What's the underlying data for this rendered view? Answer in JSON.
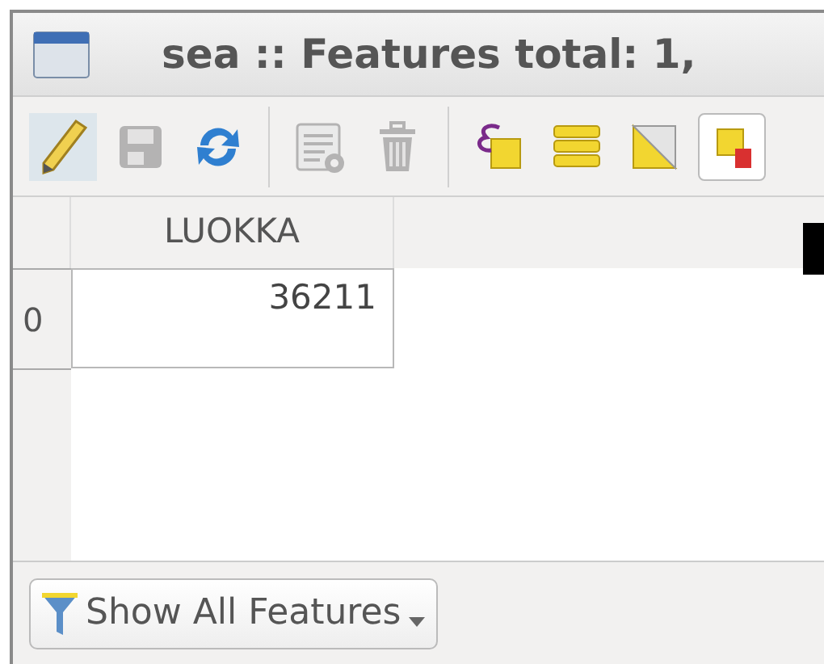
{
  "window": {
    "title": "sea :: Features total: 1,"
  },
  "toolbar": [
    {
      "kind": "edit",
      "on": true,
      "disabled": false
    },
    {
      "kind": "save",
      "on": false,
      "disabled": true
    },
    {
      "kind": "reload",
      "on": false,
      "disabled": false
    },
    {
      "kind": "separator"
    },
    {
      "kind": "new-field",
      "on": false,
      "disabled": true
    },
    {
      "kind": "delete",
      "on": false,
      "disabled": true
    },
    {
      "kind": "separator"
    },
    {
      "kind": "select-expression",
      "on": false,
      "disabled": false
    },
    {
      "kind": "select-all",
      "on": false,
      "disabled": false
    },
    {
      "kind": "invert",
      "on": false,
      "disabled": false
    },
    {
      "kind": "deselect",
      "on": false,
      "disabled": false
    }
  ],
  "table": {
    "columns": [
      "LUOKKA"
    ],
    "rows": [
      {
        "header": "0",
        "cells": [
          "36211"
        ]
      }
    ]
  },
  "filter_button": {
    "label": "Show All Features"
  }
}
